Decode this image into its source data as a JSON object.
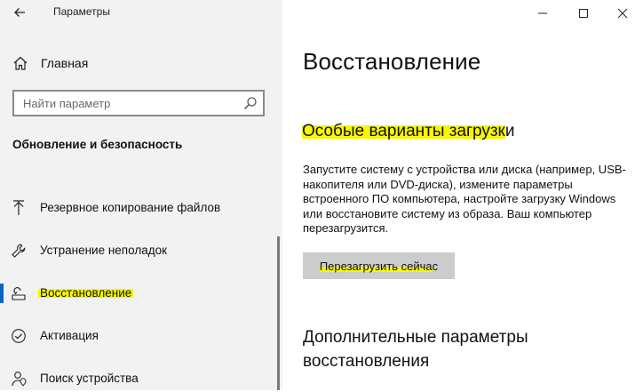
{
  "window": {
    "title": "Параметры",
    "controls": {
      "minimize_icon": "minimize-icon",
      "maximize_icon": "maximize-icon",
      "close_icon": "close-icon"
    }
  },
  "sidebar": {
    "back_icon": "back-arrow-icon",
    "home_label": "Главная",
    "search": {
      "placeholder": "Найти параметр",
      "value": ""
    },
    "section_title": "Обновление и безопасность",
    "items": [
      {
        "label": "Резервное копирование файлов",
        "icon": "backup-arrow-icon",
        "active": false
      },
      {
        "label": "Устранение неполадок",
        "icon": "wrench-icon",
        "active": false
      },
      {
        "label": "Восстановление",
        "icon": "recovery-icon",
        "active": true
      },
      {
        "label": "Активация",
        "icon": "check-circle-icon",
        "active": false
      },
      {
        "label": "Поиск устройства",
        "icon": "person-location-icon",
        "active": false
      }
    ],
    "highlight_color": "#f7f700",
    "accent_color": "#0067c0"
  },
  "main": {
    "page_title": "Восстановление",
    "special_boot": {
      "heading_highlighted": "Особые варианты загрузк",
      "heading_rest": "и",
      "description": "Запустите систему с устройства или диска (например, USB-накопителя или DVD-диска), измените параметры встроенного ПО компьютера, настройте загрузку Windows или восстановите систему из образа. Ваш компьютер перезагрузится.",
      "button_highlighted": "Перезагрузить сейча",
      "button_rest": "с"
    },
    "advanced_heading": "Дополнительные параметры восстановления"
  }
}
